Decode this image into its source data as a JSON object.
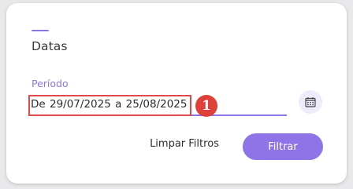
{
  "section": {
    "title": "Datas"
  },
  "period": {
    "label": "Período",
    "value": "De  29/07/2025  a  25/08/2025"
  },
  "annotation": {
    "step_number": "1",
    "color": "#e0403a"
  },
  "calendar": {
    "icon": "calendar-icon"
  },
  "actions": {
    "clear_label": "Limpar Filtros",
    "filter_label": "Filtrar"
  },
  "colors": {
    "accent": "#8e74e6",
    "highlight_border": "#e24a4a"
  }
}
